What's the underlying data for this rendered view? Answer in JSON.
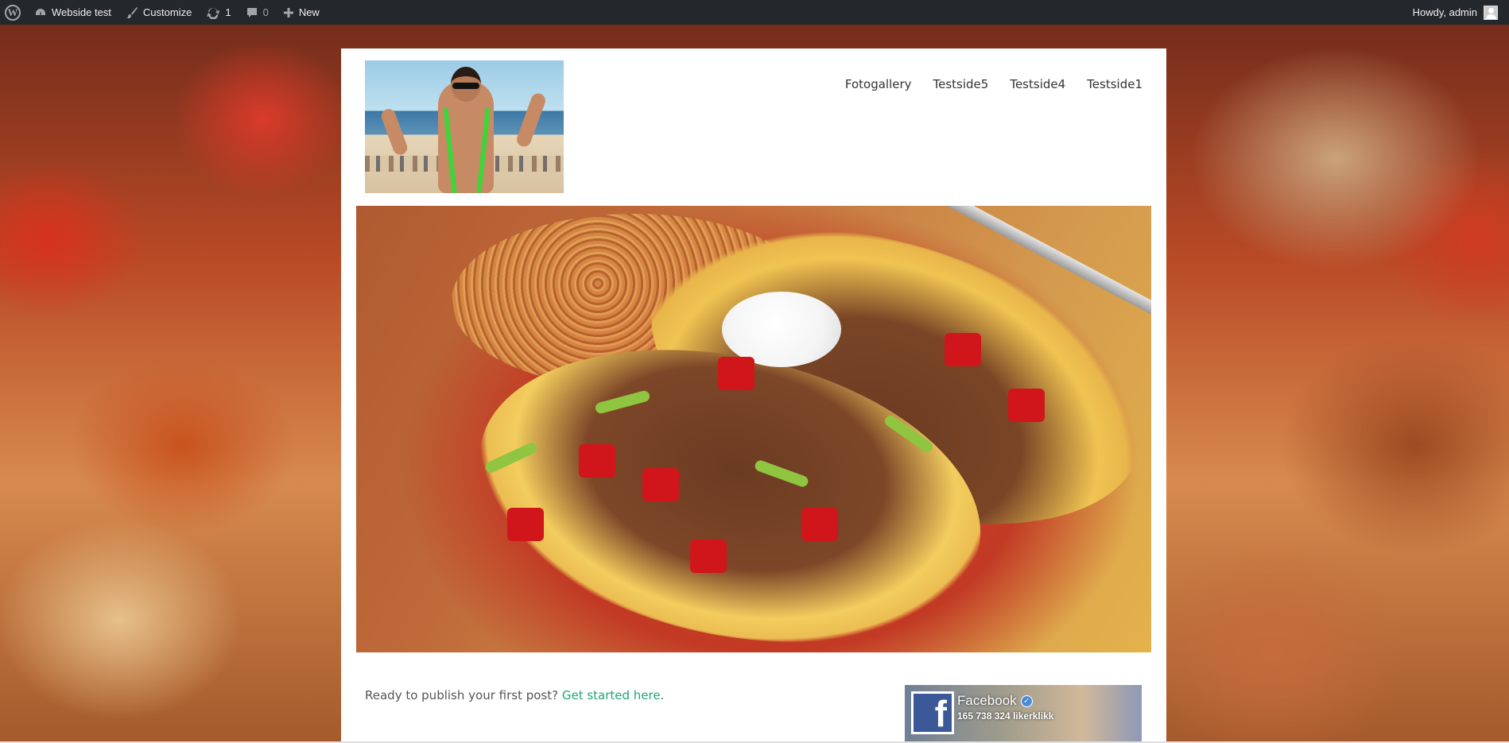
{
  "adminbar": {
    "site_name": "Webside test",
    "customize_label": "Customize",
    "updates_count": "1",
    "comments_count": "0",
    "new_label": "New",
    "howdy_label": "Howdy, admin"
  },
  "nav": {
    "items": [
      "Fotogallery",
      "Testside5",
      "Testside4",
      "Testside1"
    ]
  },
  "content": {
    "intro_text": "Ready to publish your first post? ",
    "link_text": "Get started here",
    "trailing": "."
  },
  "facebook_widget": {
    "name": "Facebook",
    "likes": "165 738 324 likerklikk",
    "logo_letter": "f"
  },
  "colors": {
    "admin_bar": "#23282d",
    "link": "#1fa67a",
    "facebook_blue": "#3b5998"
  }
}
